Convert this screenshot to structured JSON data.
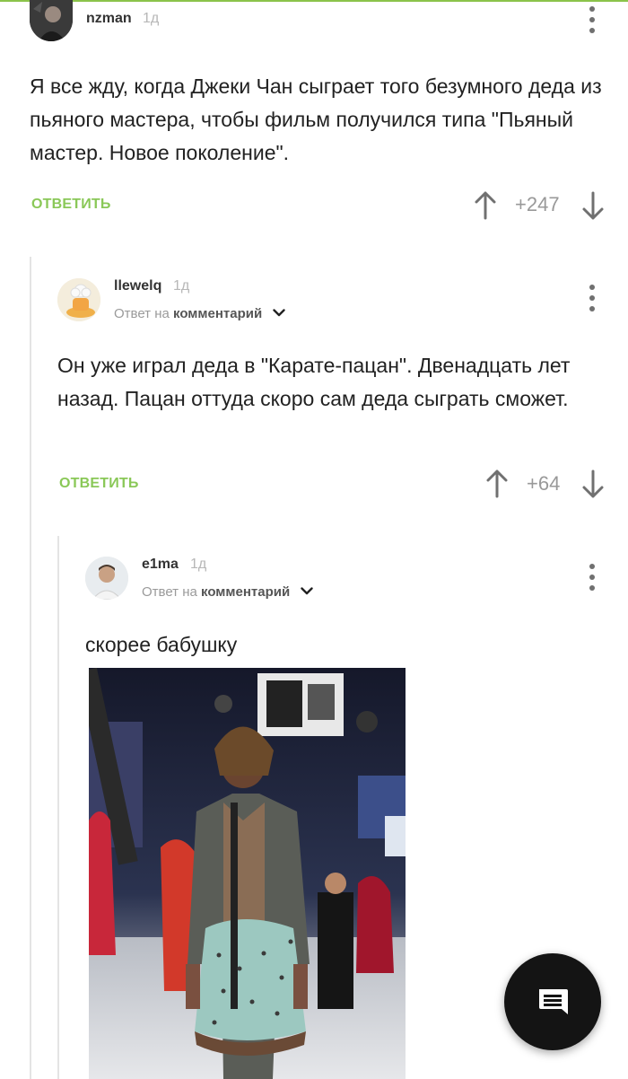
{
  "comments": [
    {
      "username": "nzman",
      "time": "1д",
      "text": "Я все жду, когда Джеки Чан сыграет того безумного деда из пьяного мастера, чтобы фильм получился типа \"Пьяный мастер. Новое поколение\".",
      "reply_label": "ОТВЕТИТЬ",
      "score": "+247"
    },
    {
      "username": "llewelq",
      "time": "1д",
      "reply_to_prefix": "Ответ на",
      "reply_to_target": "комментарий",
      "text": "Он уже играл деда в \"Карате-пацан\". Двенадцать лет назад. Пацан оттуда скоро сам деда сыграть сможет.",
      "reply_label": "ОТВЕТИТЬ",
      "score": "+64"
    },
    {
      "username": "e1ma",
      "time": "1д",
      "reply_to_prefix": "Ответ на",
      "reply_to_target": "комментарий",
      "text": "скорее бабушку"
    }
  ],
  "colors": {
    "accent": "#8ac858",
    "fab": "#141414"
  },
  "icons": [
    "more-vertical-icon",
    "arrow-up-icon",
    "arrow-down-icon",
    "chevron-down-icon",
    "chat-icon"
  ]
}
